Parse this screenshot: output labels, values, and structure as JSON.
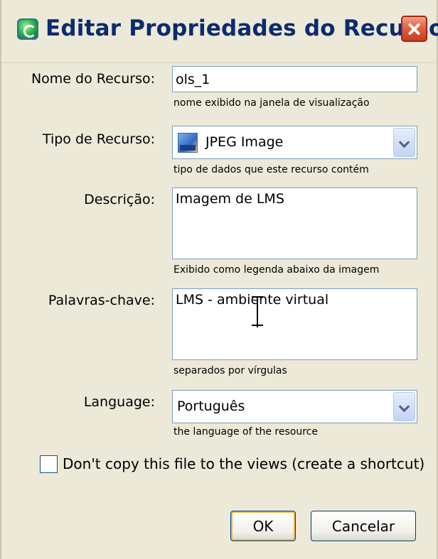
{
  "window": {
    "title": "Editar Propriedades do Recurso"
  },
  "form": {
    "name": {
      "label": "Nome do Recurso:",
      "value": "ols_1",
      "hint": "nome exibido na janela de visualização"
    },
    "type": {
      "label": "Tipo de Recurso:",
      "value": "JPEG Image",
      "icon": "jpeg-file-icon",
      "hint": "tipo de dados que este recurso contém"
    },
    "description": {
      "label": "Descrição:",
      "value": "Imagem de LMS",
      "hint": "Exibido como legenda abaixo da imagem"
    },
    "keywords": {
      "label": "Palavras-chave:",
      "value": "LMS - ambiente virtual",
      "hint": "separados por vírgulas"
    },
    "language": {
      "label": "Language:",
      "value": "Português",
      "hint": "the language of the resource"
    },
    "shortcut": {
      "label": "Don't copy this file to the views (create a shortcut)",
      "checked": false
    }
  },
  "buttons": {
    "ok": "OK",
    "cancel": "Cancelar"
  }
}
